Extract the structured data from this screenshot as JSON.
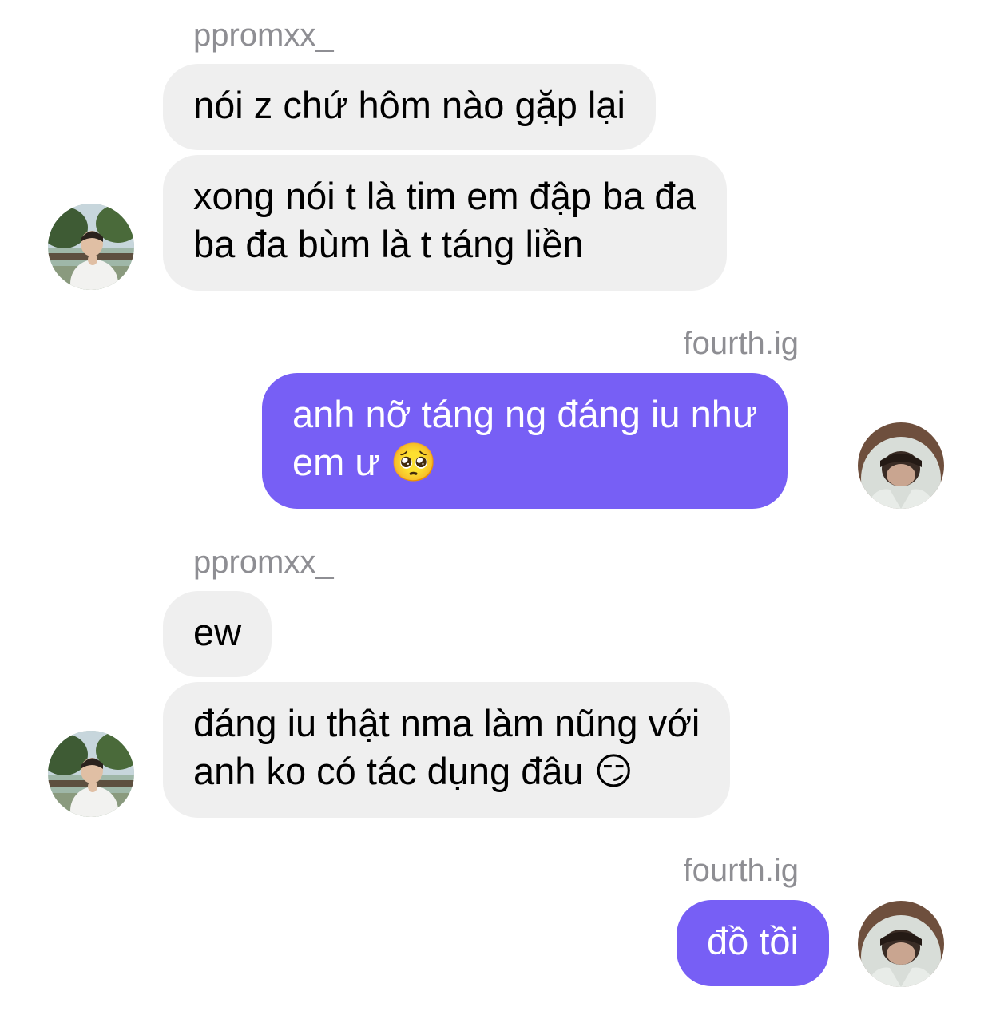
{
  "thread": {
    "messages": [
      {
        "sender": "ppromxx_",
        "direction": "in",
        "lines": [
          "nói z chứ hôm nào gặp lại"
        ]
      },
      {
        "sender": "ppromxx_",
        "direction": "in",
        "lines": [
          "xong nói t là tim em đập ba đa",
          "ba đa bùm là t táng liền"
        ]
      },
      {
        "sender": "fourth.ig",
        "direction": "out",
        "lines": [
          "anh nỡ táng ng đáng iu như",
          "em ư 🥺"
        ]
      },
      {
        "sender": "ppromxx_",
        "direction": "in",
        "lines": [
          "ew"
        ]
      },
      {
        "sender": "ppromxx_",
        "direction": "in",
        "lines": [
          "đáng iu thật nma làm nũng với",
          "anh ko có tác dụng đâu 😏"
        ]
      },
      {
        "sender": "fourth.ig",
        "direction": "out",
        "lines": [
          "đồ tồi"
        ]
      }
    ]
  },
  "labels": {
    "group1_sender": "ppromxx_",
    "group2_sender": "fourth.ig",
    "group3_sender": "ppromxx_",
    "group4_sender": "fourth.ig"
  },
  "colors": {
    "incoming_bubble": "#efefef",
    "outgoing_bubble": "#775ff5",
    "sender_label": "#8e8e93"
  },
  "icons": {
    "incoming_avatar": "avatar-photo-outdoor",
    "outgoing_avatar": "avatar-photo-hoodie"
  }
}
